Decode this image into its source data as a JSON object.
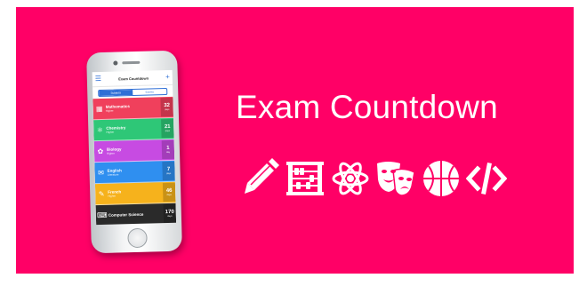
{
  "banner": {
    "background_color": "#ff0066",
    "title": "Exam Countdown",
    "icons": [
      "pencil-icon",
      "abacus-icon",
      "atom-icon",
      "theatre-masks-icon",
      "basketball-icon",
      "code-icon"
    ]
  },
  "app": {
    "header_title": "Exam Countdown",
    "menu_icon": "hamburger-icon",
    "add_icon": "plus-icon",
    "tabs": [
      {
        "label": "Subjects",
        "active": true
      },
      {
        "label": "Exams",
        "active": false
      }
    ],
    "subjects": [
      {
        "name": "Mathematics",
        "sub": "Higher",
        "count": "32",
        "unit": "days",
        "color": "#f0405c",
        "icon": "abacus-icon"
      },
      {
        "name": "Chemistry",
        "sub": "Higher",
        "count": "21",
        "unit": "days",
        "color": "#2ec777",
        "icon": "atom-icon"
      },
      {
        "name": "Biology",
        "sub": "Higher",
        "count": "1",
        "unit": "day",
        "color": "#c74be2",
        "icon": "flower-icon"
      },
      {
        "name": "English",
        "sub": "Literature",
        "count": "7",
        "unit": "days",
        "color": "#2f8ff0",
        "icon": "book-icon"
      },
      {
        "name": "French",
        "sub": "Higher",
        "count": "46",
        "unit": "days",
        "color": "#f6b21c",
        "icon": "chat-icon"
      },
      {
        "name": "Computer Science",
        "sub": "",
        "count": "170",
        "unit": "days",
        "color": "#2a2a2a",
        "icon": "code-icon"
      }
    ]
  }
}
